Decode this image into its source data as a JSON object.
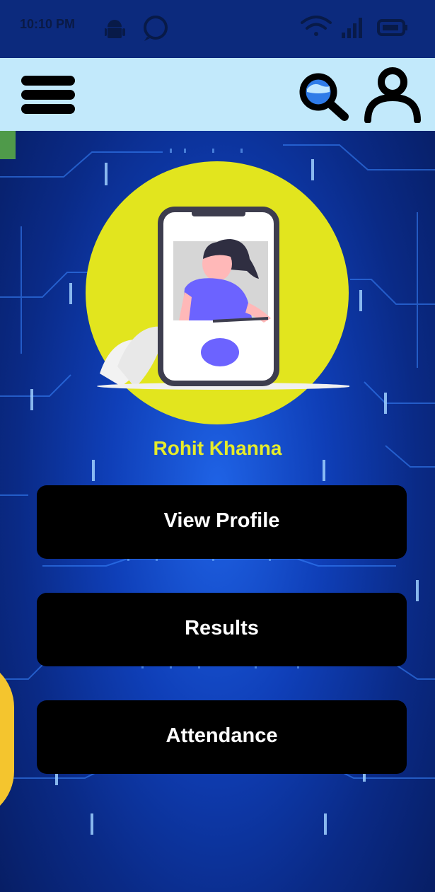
{
  "status_bar": {
    "time": "10:10 PM",
    "left_icons": [
      "android-icon",
      "whatsapp-icon"
    ],
    "right_icons": [
      "wifi-icon",
      "signal-icon",
      "battery-icon"
    ]
  },
  "app_bar": {
    "menu_icon": "hamburger-menu-icon",
    "search_icon": "search-icon",
    "profile_icon": "user-profile-icon"
  },
  "profile": {
    "name": "Rohit Khanna",
    "avatar_icon": "phone-avatar-illustration"
  },
  "menu": {
    "view_profile": "View Profile",
    "results": "Results",
    "attendance": "Attendance"
  },
  "colors": {
    "app_bar_bg": "#c2e9fb",
    "name_color": "#e6ec2a",
    "card_bg": "#000000",
    "background": "#0f3fb8",
    "avatar_circle": "#e2e51e",
    "accent_green": "#4f9a4a",
    "accent_yellow": "#f4c52e"
  }
}
